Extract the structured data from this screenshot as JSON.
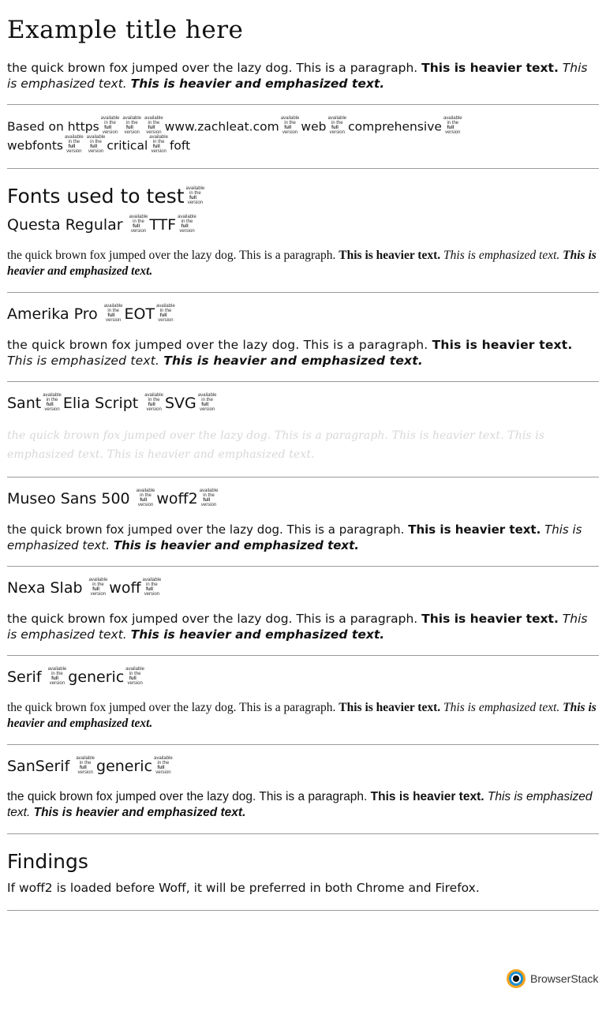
{
  "title": "Example title here",
  "intro": {
    "normal": "the quick brown fox jumped over the lazy dog. This is a paragraph.",
    "bold": "This is heavier text.",
    "italic": "This is emphasized text.",
    "bold_italic": "This is heavier and emphasized text."
  },
  "badge": {
    "line1": "available",
    "line2a": "in the",
    "line2b": "full",
    "line3": "version"
  },
  "based_on": {
    "prefix": "Based on",
    "link_https": "https",
    "link_domain": "www.zachleat.com",
    "word_web": "web",
    "word_comprehensive": "comprehensive",
    "word_webfonts": "webfonts",
    "word_critical": "critical",
    "word_foft": "foft"
  },
  "fonts_heading": "Fonts used to test",
  "sections": [
    {
      "id": "questa",
      "name": "Questa Regular",
      "format": "TTF",
      "style": "serif-para"
    },
    {
      "id": "amerika",
      "name": "Amerika Pro",
      "format": "EOT",
      "style": "amerika-para"
    },
    {
      "id": "sant",
      "name_a": "Sant",
      "name_b": "Elia Script",
      "format": "SVG",
      "style": "script-para"
    },
    {
      "id": "museo",
      "name": "Museo Sans 500",
      "format": "woff2",
      "style": "museo-para"
    },
    {
      "id": "nexa",
      "name": "Nexa Slab",
      "format": "woff",
      "style": "para-plain"
    },
    {
      "id": "serif",
      "name": "Serif",
      "format": "generic",
      "style": "serif-para"
    },
    {
      "id": "sanserif",
      "name": "SanSerif",
      "format": "generic",
      "style": "sans-para"
    }
  ],
  "sample": {
    "normal": "the quick brown fox jumped over the lazy dog. This is a paragraph.",
    "bold": "This is heavier text.",
    "italic": "This is emphasized text.",
    "bold_italic": "This is heavier and emphasized text."
  },
  "findings": {
    "heading": "Findings",
    "text": "If woff2 is loaded before Woff, it will be preferred in both Chrome and Firefox."
  },
  "footer": {
    "brand": "BrowserStack"
  }
}
